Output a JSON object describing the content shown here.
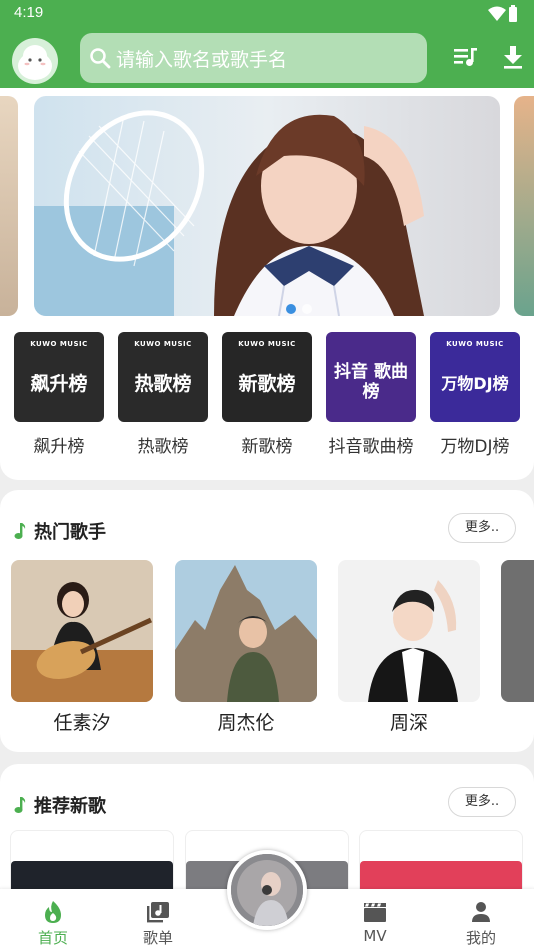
{
  "status_bar": {
    "time": "4:19"
  },
  "header": {
    "search_placeholder": "请输入歌名或歌手名",
    "accent_color": "#4caf50",
    "icons": [
      "search-icon",
      "playlist-icon",
      "download-icon"
    ]
  },
  "banner": {
    "page_count": 2,
    "active_page": 1
  },
  "ranks": [
    {
      "title": "飙升榜",
      "cover_text": "飙升榜",
      "brand": "KUWO MUSIC",
      "color": "#2b2b2b"
    },
    {
      "title": "热歌榜",
      "cover_text": "热歌榜",
      "brand": "KUWO MUSIC",
      "color": "#2a2a2a"
    },
    {
      "title": "新歌榜",
      "cover_text": "新歌榜",
      "brand": "KUWO MUSIC",
      "color": "#262626"
    },
    {
      "title": "抖音歌曲榜",
      "cover_text": "抖音 歌曲榜",
      "brand": "",
      "color": "#4a2a8a"
    },
    {
      "title": "万物DJ榜",
      "cover_text": "万物DJ榜",
      "brand": "KUWO MUSIC",
      "color": "#3b2a9a"
    }
  ],
  "hot_singers": {
    "title": "热门歌手",
    "more_label": "更多..",
    "items": [
      {
        "name": "任素汐"
      },
      {
        "name": "周杰伦"
      },
      {
        "name": "周深"
      }
    ]
  },
  "new_songs": {
    "title": "推荐新歌",
    "more_label": "更多.."
  },
  "tabbar": {
    "items": [
      {
        "label": "首页",
        "icon": "flame-icon",
        "active": true
      },
      {
        "label": "歌单",
        "icon": "album-icon",
        "active": false
      },
      {
        "label": "MV",
        "icon": "clapper-icon",
        "active": false
      },
      {
        "label": "我的",
        "icon": "person-icon",
        "active": false
      }
    ]
  }
}
